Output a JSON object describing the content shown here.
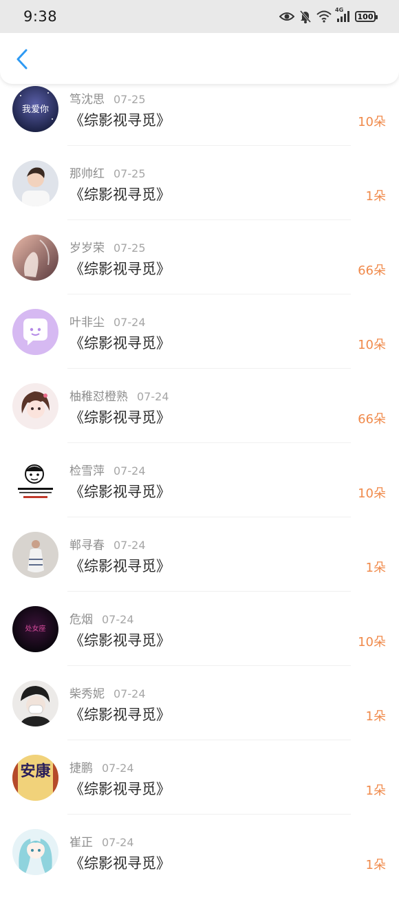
{
  "status_bar": {
    "time": "9:38",
    "network": "4G",
    "battery": "100",
    "icons": [
      "eye-icon",
      "bell-muted-icon",
      "wifi-icon",
      "signal-icon",
      "battery-icon"
    ]
  },
  "header": {
    "back_icon": "chevron-left-icon",
    "accent": "#2e9af3"
  },
  "colors": {
    "count": "#f08a4b",
    "name": "#8e8e8e",
    "title": "#2b2b2b"
  },
  "gifts": [
    {
      "name": "笃沈思",
      "date": "07-25",
      "title": "《综影视寻觅》",
      "count": "10朵"
    },
    {
      "name": "那帅红",
      "date": "07-25",
      "title": "《综影视寻觅》",
      "count": "1朵"
    },
    {
      "name": "岁岁荣",
      "date": "07-25",
      "title": "《综影视寻觅》",
      "count": "66朵"
    },
    {
      "name": "叶非尘",
      "date": "07-24",
      "title": "《综影视寻觅》",
      "count": "10朵"
    },
    {
      "name": "柚稚怼橙熟",
      "date": "07-24",
      "title": "《综影视寻觅》",
      "count": "66朵"
    },
    {
      "name": "检雪萍",
      "date": "07-24",
      "title": "《综影视寻觅》",
      "count": "10朵"
    },
    {
      "name": "郸寻春",
      "date": "07-24",
      "title": "《综影视寻觅》",
      "count": "1朵"
    },
    {
      "name": "危烟",
      "date": "07-24",
      "title": "《综影视寻觅》",
      "count": "10朵"
    },
    {
      "name": "柴秀妮",
      "date": "07-24",
      "title": "《综影视寻觅》",
      "count": "1朵"
    },
    {
      "name": "捷鹏",
      "date": "07-24",
      "title": "《综影视寻觅》",
      "count": "1朵"
    },
    {
      "name": "崔正",
      "date": "07-24",
      "title": "《综影视寻觅》",
      "count": "1朵"
    }
  ],
  "avatar_art": {
    "0": "我爱你",
    "7": "处女座",
    "9": "安康"
  }
}
